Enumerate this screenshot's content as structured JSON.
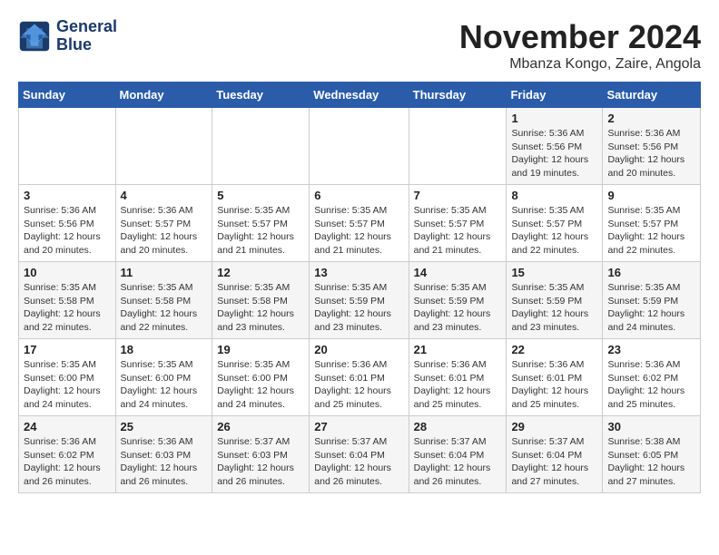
{
  "logo": {
    "line1": "General",
    "line2": "Blue"
  },
  "title": "November 2024",
  "location": "Mbanza Kongo, Zaire, Angola",
  "weekdays": [
    "Sunday",
    "Monday",
    "Tuesday",
    "Wednesday",
    "Thursday",
    "Friday",
    "Saturday"
  ],
  "weeks": [
    [
      {
        "day": "",
        "info": ""
      },
      {
        "day": "",
        "info": ""
      },
      {
        "day": "",
        "info": ""
      },
      {
        "day": "",
        "info": ""
      },
      {
        "day": "",
        "info": ""
      },
      {
        "day": "1",
        "info": "Sunrise: 5:36 AM\nSunset: 5:56 PM\nDaylight: 12 hours\nand 19 minutes."
      },
      {
        "day": "2",
        "info": "Sunrise: 5:36 AM\nSunset: 5:56 PM\nDaylight: 12 hours\nand 20 minutes."
      }
    ],
    [
      {
        "day": "3",
        "info": "Sunrise: 5:36 AM\nSunset: 5:56 PM\nDaylight: 12 hours\nand 20 minutes."
      },
      {
        "day": "4",
        "info": "Sunrise: 5:36 AM\nSunset: 5:57 PM\nDaylight: 12 hours\nand 20 minutes."
      },
      {
        "day": "5",
        "info": "Sunrise: 5:35 AM\nSunset: 5:57 PM\nDaylight: 12 hours\nand 21 minutes."
      },
      {
        "day": "6",
        "info": "Sunrise: 5:35 AM\nSunset: 5:57 PM\nDaylight: 12 hours\nand 21 minutes."
      },
      {
        "day": "7",
        "info": "Sunrise: 5:35 AM\nSunset: 5:57 PM\nDaylight: 12 hours\nand 21 minutes."
      },
      {
        "day": "8",
        "info": "Sunrise: 5:35 AM\nSunset: 5:57 PM\nDaylight: 12 hours\nand 22 minutes."
      },
      {
        "day": "9",
        "info": "Sunrise: 5:35 AM\nSunset: 5:57 PM\nDaylight: 12 hours\nand 22 minutes."
      }
    ],
    [
      {
        "day": "10",
        "info": "Sunrise: 5:35 AM\nSunset: 5:58 PM\nDaylight: 12 hours\nand 22 minutes."
      },
      {
        "day": "11",
        "info": "Sunrise: 5:35 AM\nSunset: 5:58 PM\nDaylight: 12 hours\nand 22 minutes."
      },
      {
        "day": "12",
        "info": "Sunrise: 5:35 AM\nSunset: 5:58 PM\nDaylight: 12 hours\nand 23 minutes."
      },
      {
        "day": "13",
        "info": "Sunrise: 5:35 AM\nSunset: 5:59 PM\nDaylight: 12 hours\nand 23 minutes."
      },
      {
        "day": "14",
        "info": "Sunrise: 5:35 AM\nSunset: 5:59 PM\nDaylight: 12 hours\nand 23 minutes."
      },
      {
        "day": "15",
        "info": "Sunrise: 5:35 AM\nSunset: 5:59 PM\nDaylight: 12 hours\nand 23 minutes."
      },
      {
        "day": "16",
        "info": "Sunrise: 5:35 AM\nSunset: 5:59 PM\nDaylight: 12 hours\nand 24 minutes."
      }
    ],
    [
      {
        "day": "17",
        "info": "Sunrise: 5:35 AM\nSunset: 6:00 PM\nDaylight: 12 hours\nand 24 minutes."
      },
      {
        "day": "18",
        "info": "Sunrise: 5:35 AM\nSunset: 6:00 PM\nDaylight: 12 hours\nand 24 minutes."
      },
      {
        "day": "19",
        "info": "Sunrise: 5:35 AM\nSunset: 6:00 PM\nDaylight: 12 hours\nand 24 minutes."
      },
      {
        "day": "20",
        "info": "Sunrise: 5:36 AM\nSunset: 6:01 PM\nDaylight: 12 hours\nand 25 minutes."
      },
      {
        "day": "21",
        "info": "Sunrise: 5:36 AM\nSunset: 6:01 PM\nDaylight: 12 hours\nand 25 minutes."
      },
      {
        "day": "22",
        "info": "Sunrise: 5:36 AM\nSunset: 6:01 PM\nDaylight: 12 hours\nand 25 minutes."
      },
      {
        "day": "23",
        "info": "Sunrise: 5:36 AM\nSunset: 6:02 PM\nDaylight: 12 hours\nand 25 minutes."
      }
    ],
    [
      {
        "day": "24",
        "info": "Sunrise: 5:36 AM\nSunset: 6:02 PM\nDaylight: 12 hours\nand 26 minutes."
      },
      {
        "day": "25",
        "info": "Sunrise: 5:36 AM\nSunset: 6:03 PM\nDaylight: 12 hours\nand 26 minutes."
      },
      {
        "day": "26",
        "info": "Sunrise: 5:37 AM\nSunset: 6:03 PM\nDaylight: 12 hours\nand 26 minutes."
      },
      {
        "day": "27",
        "info": "Sunrise: 5:37 AM\nSunset: 6:04 PM\nDaylight: 12 hours\nand 26 minutes."
      },
      {
        "day": "28",
        "info": "Sunrise: 5:37 AM\nSunset: 6:04 PM\nDaylight: 12 hours\nand 26 minutes."
      },
      {
        "day": "29",
        "info": "Sunrise: 5:37 AM\nSunset: 6:04 PM\nDaylight: 12 hours\nand 27 minutes."
      },
      {
        "day": "30",
        "info": "Sunrise: 5:38 AM\nSunset: 6:05 PM\nDaylight: 12 hours\nand 27 minutes."
      }
    ]
  ]
}
